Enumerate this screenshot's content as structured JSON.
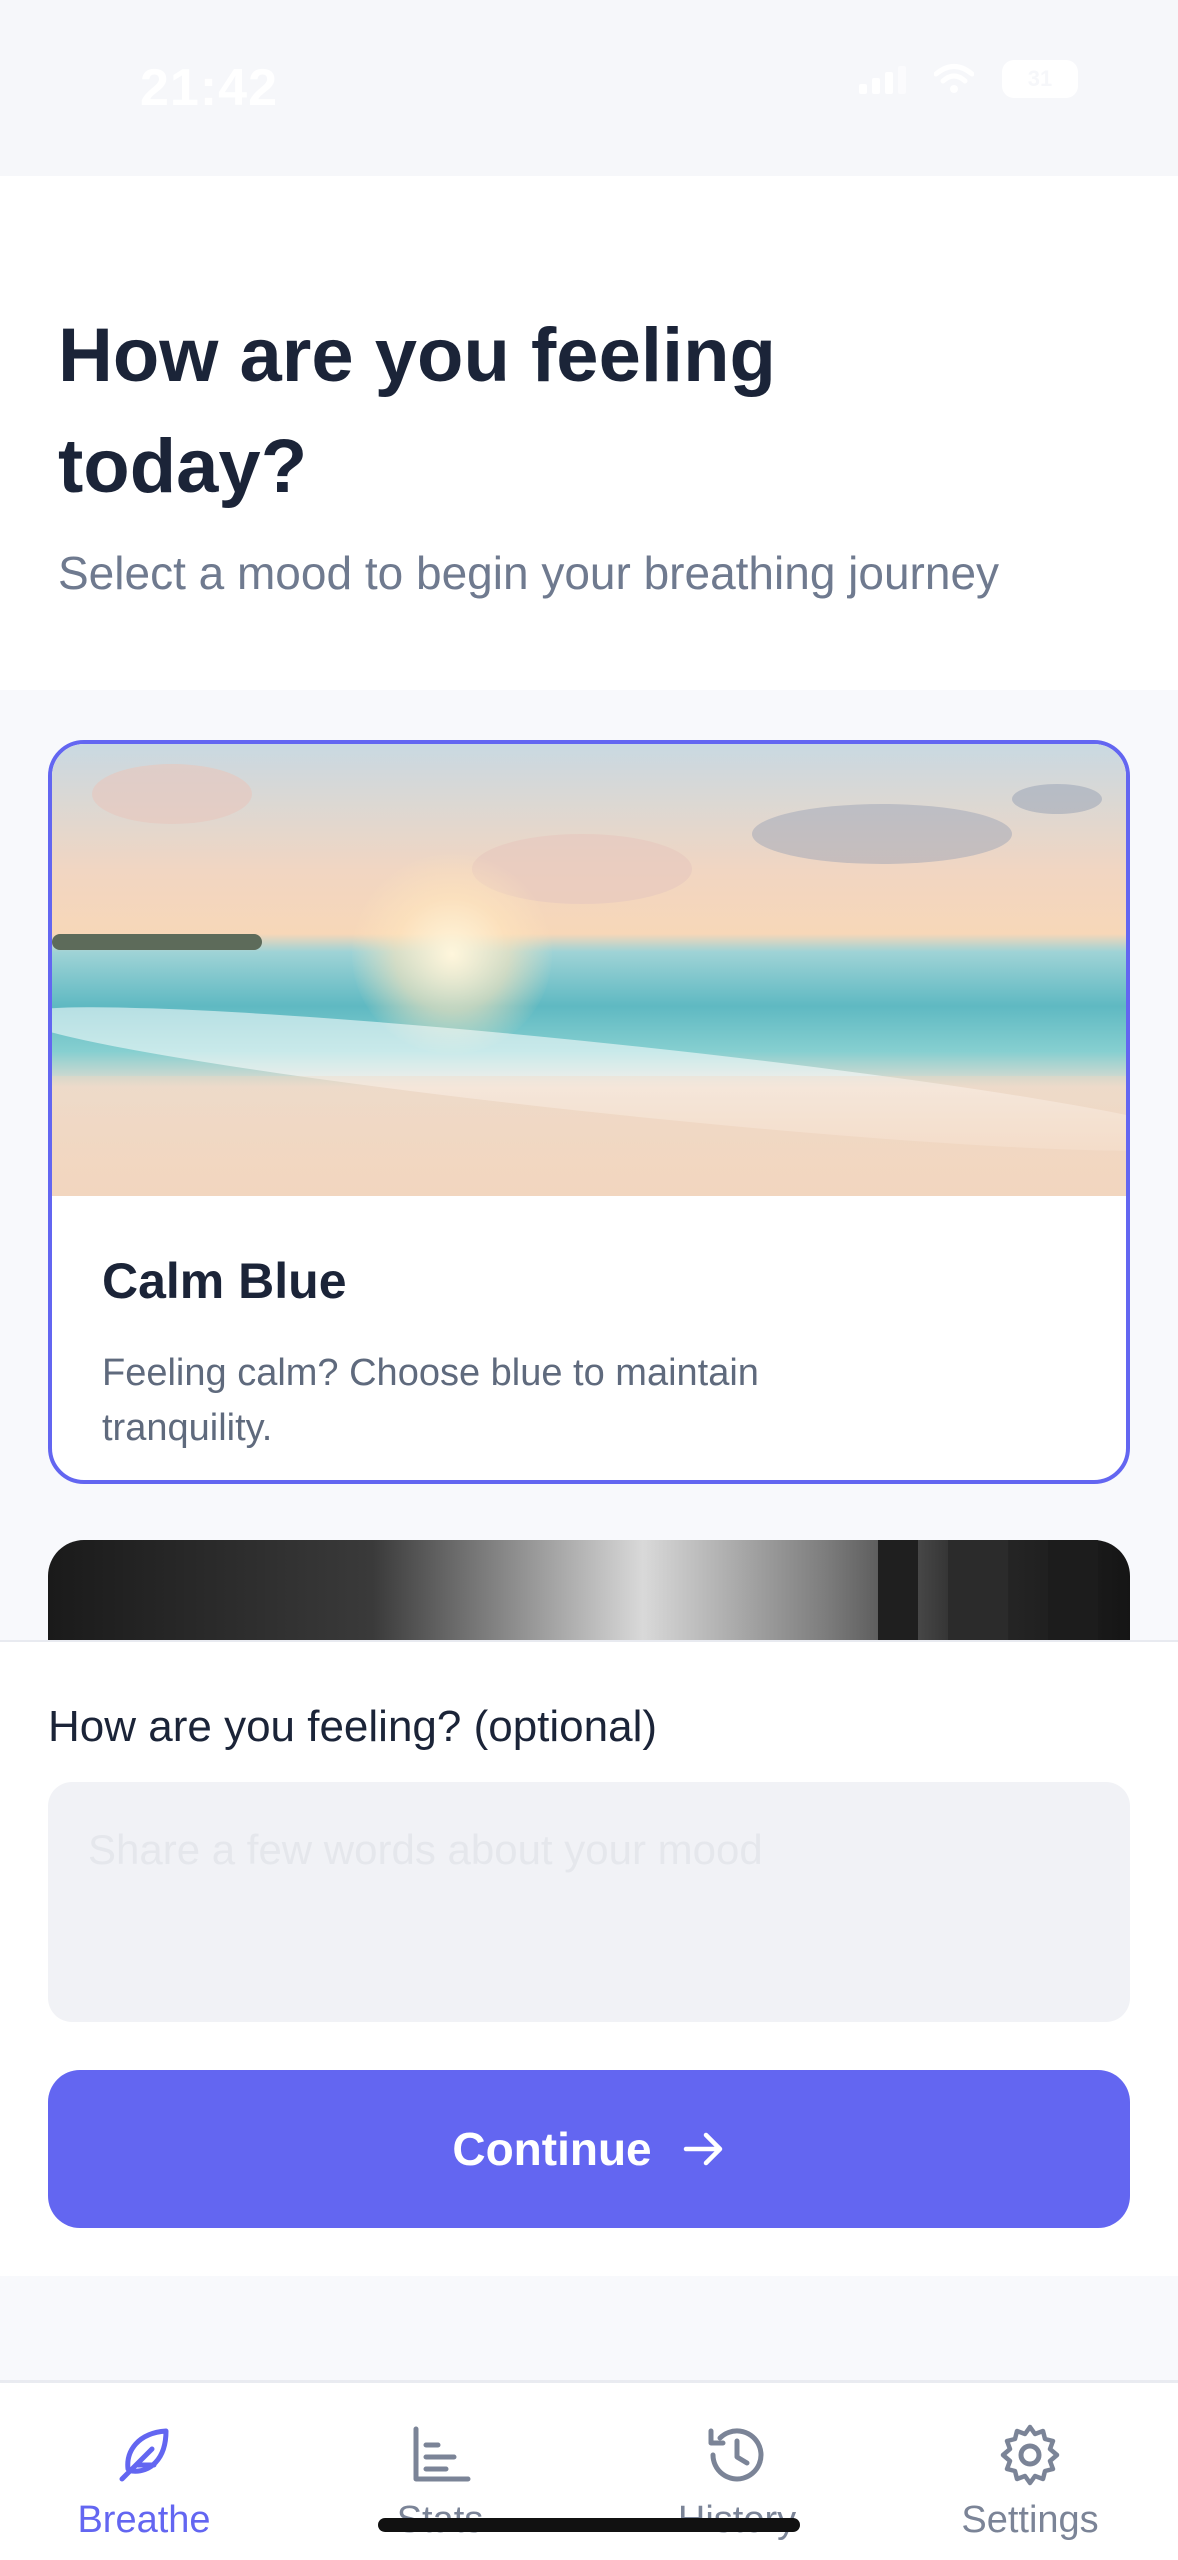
{
  "status_bar": {
    "time": "21:42",
    "battery": "31"
  },
  "header": {
    "title": "How are you feeling today?",
    "subtitle": "Select a mood to begin your breathing journey"
  },
  "moods": [
    {
      "title": "Calm Blue",
      "description": "Feeling calm? Choose blue to maintain tranquility.",
      "selected": true
    }
  ],
  "feeling_input": {
    "label": "How are you feeling? (optional)",
    "placeholder": "Share a few words about your mood",
    "value": ""
  },
  "continue_button": {
    "label": "Continue"
  },
  "tabs": [
    {
      "label": "Breathe",
      "icon": "feather-icon",
      "active": true
    },
    {
      "label": "Stats",
      "icon": "chart-icon",
      "active": false
    },
    {
      "label": "History",
      "icon": "history-icon",
      "active": false
    },
    {
      "label": "Settings",
      "icon": "gear-icon",
      "active": false
    }
  ],
  "colors": {
    "accent": "#6366f1",
    "title": "#1b2438",
    "muted": "#6f7a8f"
  }
}
